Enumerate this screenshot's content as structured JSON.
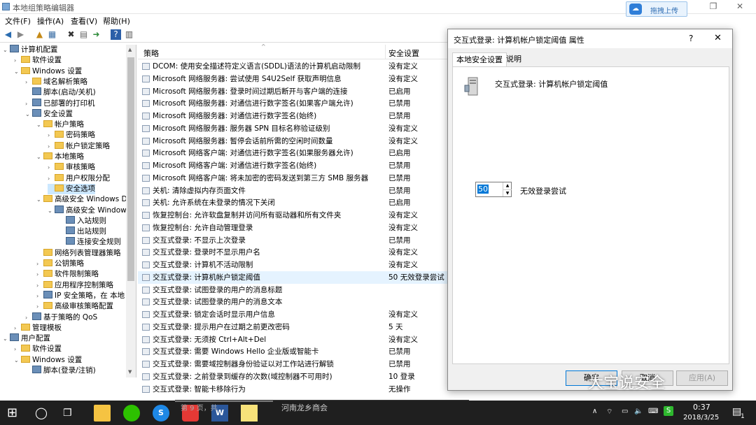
{
  "window": {
    "title": "本地组策略编辑器",
    "upload_button": "拖拽上传",
    "upload_icon": "cloud-icon"
  },
  "menu": [
    "文件(F)",
    "操作(A)",
    "查看(V)",
    "帮助(H)"
  ],
  "tree": [
    {
      "label": "计算机配置",
      "indent": 0,
      "exp": "v",
      "icon": "computer"
    },
    {
      "label": "软件设置",
      "indent": 1,
      "exp": ">",
      "icon": "folder"
    },
    {
      "label": "Windows 设置",
      "indent": 1,
      "exp": "v",
      "icon": "folder"
    },
    {
      "label": "域名解析策略",
      "indent": 2,
      "exp": ">",
      "icon": "folder"
    },
    {
      "label": "脚本(启动/关机)",
      "indent": 2,
      "exp": "",
      "icon": "script"
    },
    {
      "label": "已部署的打印机",
      "indent": 2,
      "exp": ">",
      "icon": "printer"
    },
    {
      "label": "安全设置",
      "indent": 2,
      "exp": "v",
      "icon": "shield"
    },
    {
      "label": "帐户策略",
      "indent": 3,
      "exp": "v",
      "icon": "folder"
    },
    {
      "label": "密码策略",
      "indent": 4,
      "exp": ">",
      "icon": "folder"
    },
    {
      "label": "帐户锁定策略",
      "indent": 4,
      "exp": ">",
      "icon": "folder"
    },
    {
      "label": "本地策略",
      "indent": 3,
      "exp": "v",
      "icon": "folder"
    },
    {
      "label": "审核策略",
      "indent": 4,
      "exp": ">",
      "icon": "folder"
    },
    {
      "label": "用户权限分配",
      "indent": 4,
      "exp": ">",
      "icon": "folder"
    },
    {
      "label": "安全选项",
      "indent": 4,
      "exp": "",
      "icon": "folder",
      "selected": true
    },
    {
      "label": "高级安全 Windows D",
      "indent": 3,
      "exp": "v",
      "icon": "folder"
    },
    {
      "label": "高级安全 Window",
      "indent": 4,
      "exp": "v",
      "icon": "firewall"
    },
    {
      "label": "入站规则",
      "indent": 5,
      "exp": "",
      "icon": "rule"
    },
    {
      "label": "出站规则",
      "indent": 5,
      "exp": "",
      "icon": "rule"
    },
    {
      "label": "连接安全规则",
      "indent": 5,
      "exp": "",
      "icon": "rule"
    },
    {
      "label": "网络列表管理器策略",
      "indent": 3,
      "exp": "",
      "icon": "folder"
    },
    {
      "label": "公钥策略",
      "indent": 3,
      "exp": ">",
      "icon": "folder"
    },
    {
      "label": "软件限制策略",
      "indent": 3,
      "exp": ">",
      "icon": "folder"
    },
    {
      "label": "应用程序控制策略",
      "indent": 3,
      "exp": ">",
      "icon": "folder"
    },
    {
      "label": "IP 安全策略，在 本地",
      "indent": 3,
      "exp": ">",
      "icon": "ipsec"
    },
    {
      "label": "高级审核策略配置",
      "indent": 3,
      "exp": ">",
      "icon": "folder"
    },
    {
      "label": "基于策略的 QoS",
      "indent": 2,
      "exp": ">",
      "icon": "chart"
    },
    {
      "label": "管理模板",
      "indent": 1,
      "exp": ">",
      "icon": "folder"
    },
    {
      "label": "用户配置",
      "indent": 0,
      "exp": "v",
      "icon": "user"
    },
    {
      "label": "软件设置",
      "indent": 1,
      "exp": ">",
      "icon": "folder"
    },
    {
      "label": "Windows 设置",
      "indent": 1,
      "exp": "v",
      "icon": "folder"
    },
    {
      "label": "脚本(登录/注销)",
      "indent": 2,
      "exp": "",
      "icon": "script"
    }
  ],
  "list": {
    "col_policy": "策略",
    "col_setting": "安全设置",
    "rows": [
      {
        "policy": "DCOM: 使用安全描述符定义语言(SDDL)语法的计算机启动限制",
        "setting": "没有定义"
      },
      {
        "policy": "Microsoft 网络服务器: 尝试使用 S4U2Self 获取声明信息",
        "setting": "没有定义"
      },
      {
        "policy": "Microsoft 网络服务器: 登录时间过期后断开与客户端的连接",
        "setting": "已启用"
      },
      {
        "policy": "Microsoft 网络服务器: 对通信进行数字签名(如果客户端允许)",
        "setting": "已禁用"
      },
      {
        "policy": "Microsoft 网络服务器: 对通信进行数字签名(始终)",
        "setting": "已禁用"
      },
      {
        "policy": "Microsoft 网络服务器: 服务器 SPN 目标名称验证级别",
        "setting": "没有定义"
      },
      {
        "policy": "Microsoft 网络服务器: 暂停会话前所需的空闲时间数量",
        "setting": "没有定义"
      },
      {
        "policy": "Microsoft 网络客户端: 对通信进行数字签名(如果服务器允许)",
        "setting": "已启用"
      },
      {
        "policy": "Microsoft 网络客户端: 对通信进行数字签名(始终)",
        "setting": "已禁用"
      },
      {
        "policy": "Microsoft 网络客户端: 将未加密的密码发送到第三方 SMB 服务器",
        "setting": "已禁用"
      },
      {
        "policy": "关机: 清除虚拟内存页面文件",
        "setting": "已禁用"
      },
      {
        "policy": "关机: 允许系统在未登录的情况下关闭",
        "setting": "已启用"
      },
      {
        "policy": "恢复控制台: 允许软盘复制并访问所有驱动器和所有文件夹",
        "setting": "没有定义"
      },
      {
        "policy": "恢复控制台: 允许自动管理登录",
        "setting": "没有定义"
      },
      {
        "policy": "交互式登录: 不显示上次登录",
        "setting": "已禁用"
      },
      {
        "policy": "交互式登录: 登录时不显示用户名",
        "setting": "没有定义"
      },
      {
        "policy": "交互式登录: 计算机不活动限制",
        "setting": "没有定义"
      },
      {
        "policy": "交互式登录: 计算机帐户锁定阈值",
        "setting": "50 无效登录尝试",
        "highlight": true
      },
      {
        "policy": "交互式登录: 试图登录的用户的消息标题",
        "setting": ""
      },
      {
        "policy": "交互式登录: 试图登录的用户的消息文本",
        "setting": ""
      },
      {
        "policy": "交互式登录: 锁定会话时显示用户信息",
        "setting": "没有定义"
      },
      {
        "policy": "交互式登录: 提示用户在过期之前更改密码",
        "setting": "5 天"
      },
      {
        "policy": "交互式登录: 无须按 Ctrl+Alt+Del",
        "setting": "没有定义"
      },
      {
        "policy": "交互式登录: 需要 Windows Hello 企业版或智能卡",
        "setting": "已禁用"
      },
      {
        "policy": "交互式登录: 需要域控制器身份验证以对工作站进行解锁",
        "setting": "已禁用"
      },
      {
        "policy": "交互式登录: 之前登录到缓存的次数(域控制器不可用时)",
        "setting": "10 登录"
      },
      {
        "policy": "交互式登录: 智能卡移除行为",
        "setting": "无操作"
      }
    ]
  },
  "dialog": {
    "title": "交互式登录: 计算机帐户锁定阈值 属性",
    "help": "?",
    "tabs": [
      "本地安全设置",
      "说明"
    ],
    "policy_name": "交互式登录: 计算机帐户锁定阈值",
    "value": "50",
    "value_label": "无效登录尝试",
    "buttons": {
      "ok": "确定",
      "cancel": "取消",
      "apply": "应用(A)"
    }
  },
  "taskbar": {
    "behind_text": "河南龙乡商会",
    "behind_prefix": "第 9 页，共",
    "time": "0:37",
    "date": "2018/3/25",
    "input_method": "S",
    "notification_count": "1"
  },
  "watermark": "大宝说安全"
}
